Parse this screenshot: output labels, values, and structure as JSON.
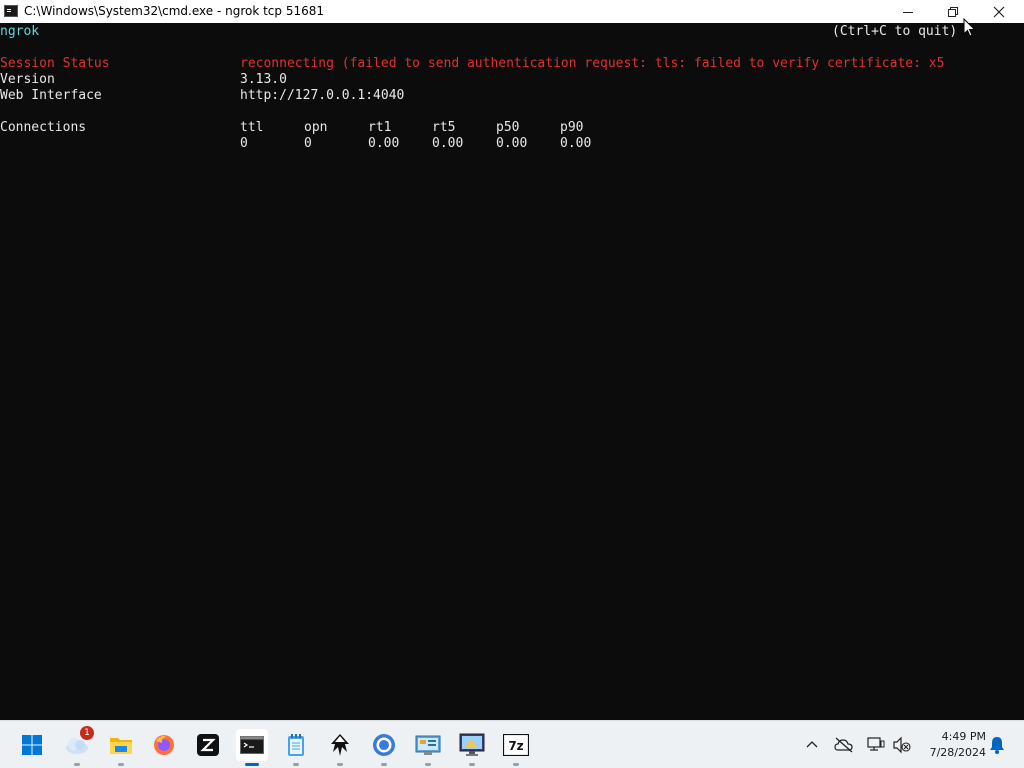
{
  "window": {
    "title": "C:\\Windows\\System32\\cmd.exe - ngrok  tcp 51681",
    "icon": "console-icon",
    "controls": [
      "minimize-icon",
      "restore-icon",
      "close-icon"
    ]
  },
  "terminal": {
    "app_name": "ngrok",
    "quit_hint": "(Ctrl+C to quit)",
    "rows": {
      "session_status": {
        "label": "Session Status",
        "value": "reconnecting (failed to send authentication request: tls: failed to verify certificate: x5"
      },
      "version": {
        "label": "Version",
        "value": "3.13.0"
      },
      "web_interface": {
        "label": "Web Interface",
        "value": "http://127.0.0.1:4040"
      },
      "connections": {
        "label": "Connections",
        "headers": [
          "ttl",
          "opn",
          "rt1",
          "rt5",
          "p50",
          "p90"
        ],
        "values": [
          "0",
          "0",
          "0.00",
          "0.00",
          "0.00",
          "0.00"
        ]
      }
    },
    "colors": {
      "background": "#0c0c0c",
      "text": "#cccccc",
      "cyan": "#61d6d6",
      "red": "#e03030"
    }
  },
  "taskbar": {
    "items": [
      {
        "name": "start-icon"
      },
      {
        "name": "weather-icon",
        "badge": "1"
      },
      {
        "name": "file-explorer-icon"
      },
      {
        "name": "firefox-icon"
      },
      {
        "name": "zed-icon"
      },
      {
        "name": "terminal-icon",
        "active": true
      },
      {
        "name": "notepad-icon"
      },
      {
        "name": "inkscape-icon"
      },
      {
        "name": "chrome-icon"
      },
      {
        "name": "control-panel-icon"
      },
      {
        "name": "remote-desktop-icon"
      },
      {
        "name": "7zip-icon"
      }
    ],
    "tray": [
      "chevron-up-icon",
      "onedrive-offline-icon",
      "network-disconnected-icon",
      "volume-muted-icon"
    ],
    "clock": {
      "time": "4:49 PM",
      "date": "7/28/2024"
    },
    "notification_icon": "bell-icon"
  }
}
